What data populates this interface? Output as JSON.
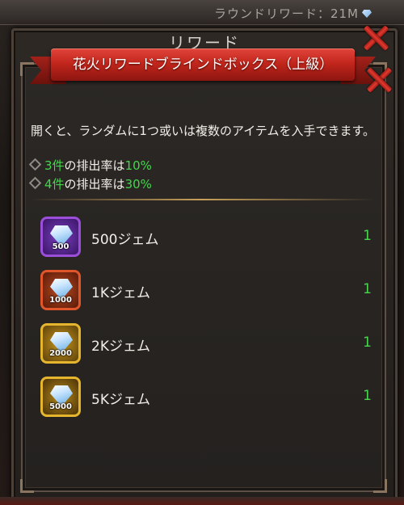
{
  "top_bar": {
    "round_reward_text": "ラウンドリワード：21M"
  },
  "outer_dialog": {
    "title": "リワード"
  },
  "dialog": {
    "title": "花火リワードブラインドボックス（上級）",
    "description": "開くと、ランダムに1つ或いは複数のアイテムを入手できます。",
    "rates": [
      {
        "count_label": "3件",
        "middle": "の排出率は",
        "rate": "10%"
      },
      {
        "count_label": "4件",
        "middle": "の排出率は",
        "rate": "30%"
      }
    ]
  },
  "rewards": [
    {
      "name": "500ジェム",
      "icon_number": "500",
      "quantity": "1",
      "frame_color": "#9b4fd8",
      "bg_color": "#4a1d78"
    },
    {
      "name": "1Kジェム",
      "icon_number": "1000",
      "quantity": "1",
      "frame_color": "#e0552a",
      "bg_color": "#7a2410"
    },
    {
      "name": "2Kジェム",
      "icon_number": "2000",
      "quantity": "1",
      "frame_color": "#e6b52e",
      "bg_color": "#7a5c10"
    },
    {
      "name": "5Kジェム",
      "icon_number": "5000",
      "quantity": "1",
      "frame_color": "#e6b52e",
      "bg_color": "#6a4a0c"
    }
  ],
  "colors": {
    "highlight_green": "#45d64b",
    "ribbon_red": "#c2261c"
  }
}
